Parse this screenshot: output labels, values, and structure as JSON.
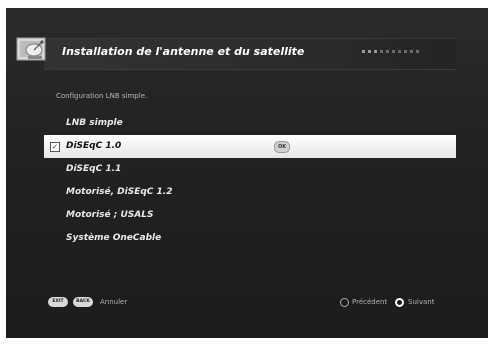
{
  "header": {
    "title": "Installation de l'antenne et du satellite",
    "icon": "satellite-dish-icon"
  },
  "subtitle": "Configuration LNB simple.",
  "menu": {
    "items": [
      {
        "label": "LNB simple"
      },
      {
        "label": "DiSEqC 1.0"
      },
      {
        "label": "DiSEqC 1.1"
      },
      {
        "label": "Motorisé, DiSEqC 1.2"
      },
      {
        "label": "Motorisé ; USALS"
      },
      {
        "label": "Système OneCable"
      }
    ],
    "selected_index": 1,
    "check_mark": "✓",
    "ok_label": "OK"
  },
  "footer": {
    "exit_label": "EXIT",
    "back_label": "BACK",
    "cancel_label": "Annuler",
    "previous_label": "Précédent",
    "next_label": "Suivant"
  },
  "colors": {
    "background": "#222222",
    "selected_row": "#f2f2f2"
  }
}
